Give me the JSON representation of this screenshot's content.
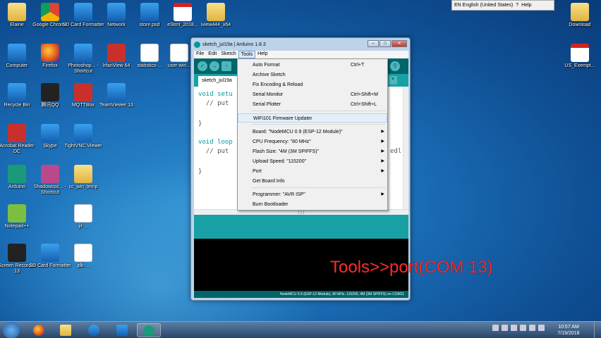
{
  "desktop": {
    "icons": [
      {
        "label": "Elaine"
      },
      {
        "label": "Google Chrome"
      },
      {
        "label": "SD Card Formatter"
      },
      {
        "label": "Network"
      },
      {
        "label": "store.psd"
      },
      {
        "label": "eStmt_2018..."
      },
      {
        "label": "iview444_x64"
      },
      {
        "label": "Computer"
      },
      {
        "label": "Firefox"
      },
      {
        "label": "Photoshop... - Shortcut"
      },
      {
        "label": "IrfanView 64"
      },
      {
        "label": "statistics-..."
      },
      {
        "label": "user-wiri..."
      },
      {
        "label": "Recycle Bin"
      },
      {
        "label": "腾讯QQ"
      },
      {
        "label": "MQTTBox"
      },
      {
        "label": "TeamViewer 13"
      },
      {
        "label": "Acrobat Reader DC"
      },
      {
        "label": "Skype"
      },
      {
        "label": "TightVNC Viewer"
      },
      {
        "label": "Arduino"
      },
      {
        "label": "Shadowsoc... - Shortcut"
      },
      {
        "label": "cc_win_temp"
      },
      {
        "label": "Notepad++"
      },
      {
        "label": "jit-..."
      },
      {
        "label": "Screen Recorder 13"
      },
      {
        "label": "SD Card Formatter"
      },
      {
        "label": "jdk-..."
      },
      {
        "label": "Download"
      },
      {
        "label": "US_Exempt..."
      }
    ]
  },
  "langbar": {
    "text": "EN English (United States)",
    "help": "Help"
  },
  "window": {
    "title": "sketch_jul19a | Arduino 1.8.3",
    "menus": [
      "File",
      "Edit",
      "Sketch",
      "Tools",
      "Help"
    ],
    "tab": "sketch_jul19a",
    "code": [
      "void setu",
      "  // put",
      "}",
      "void loop",
      "  // put",
      "}"
    ],
    "code_tail": "edl",
    "status": "NodeMCU 0.9 (ESP-12 Module), 80 MHz, 115200, 4M (3M SPIFFS) on COM11"
  },
  "tools_menu": {
    "items": [
      {
        "label": "Auto Format",
        "shortcut": "Ctrl+T"
      },
      {
        "label": "Archive Sketch",
        "shortcut": ""
      },
      {
        "label": "Fix Encoding & Reload",
        "shortcut": ""
      },
      {
        "label": "Serial Monitor",
        "shortcut": "Ctrl+Shift+M"
      },
      {
        "label": "Serial Plotter",
        "shortcut": "Ctrl+Shift+L"
      },
      {
        "label": "WiFi101 Firmware Updater",
        "shortcut": ""
      },
      {
        "label": "Board: \"NodeMCU 0.9 (ESP-12 Module)\"",
        "submenu": true
      },
      {
        "label": "CPU Frequency: \"80 MHz\"",
        "submenu": true
      },
      {
        "label": "Flash Size: \"4M (3M SPIFFS)\"",
        "submenu": true
      },
      {
        "label": "Upload Speed: \"115200\"",
        "submenu": true
      },
      {
        "label": "Port",
        "submenu": true
      },
      {
        "label": "Get Board Info"
      },
      {
        "label": "Programmer: \"AVR ISP\"",
        "submenu": true
      },
      {
        "label": "Burn Bootloader"
      }
    ]
  },
  "overlay_text": "Tools>>port(COM 13)",
  "taskbar": {
    "time": "10:57 AM",
    "date": "7/19/2018"
  }
}
